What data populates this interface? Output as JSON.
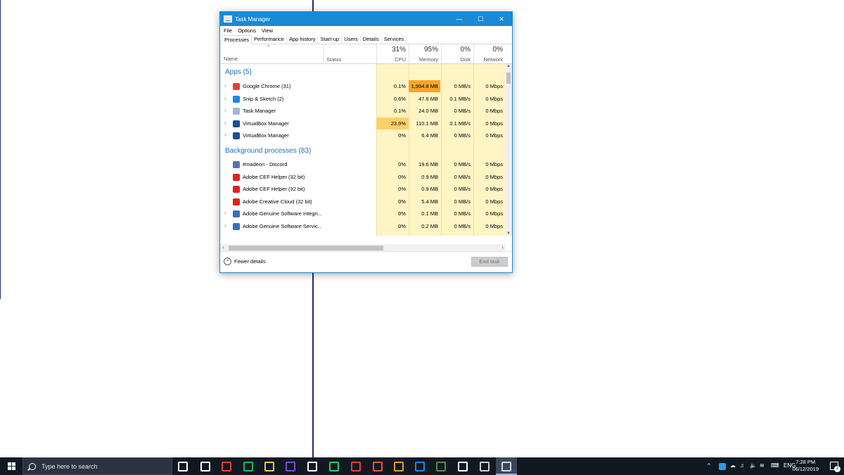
{
  "window": {
    "title": "Task Manager",
    "controls": {
      "minimize": "—",
      "maximize": "☐",
      "close": "✕"
    }
  },
  "menu": [
    "File",
    "Options",
    "View"
  ],
  "tabs": [
    "Processes",
    "Performance",
    "App history",
    "Start-up",
    "Users",
    "Details",
    "Services"
  ],
  "columns": {
    "sort_caret": "^",
    "name": "Name",
    "status": "Status",
    "cpu": {
      "pct": "31%",
      "label": "CPU"
    },
    "memory": {
      "pct": "95%",
      "label": "Memory"
    },
    "disk": {
      "pct": "0%",
      "label": "Disk"
    },
    "network": {
      "pct": "0%",
      "label": "Network"
    }
  },
  "groups": {
    "apps": "Apps (5)",
    "background": "Background processes (83)"
  },
  "apps": [
    {
      "name": "Google Chrome (31)",
      "cpu": "0.1%",
      "memory": "1,994.8 MB",
      "disk": "0 MB/s",
      "network": "0 Mbps",
      "icon_color": "#db4437"
    },
    {
      "name": "Snip & Sketch (2)",
      "cpu": "0.6%",
      "memory": "47.6 MB",
      "disk": "0.1 MB/s",
      "network": "0 Mbps",
      "icon_color": "#1e88e5"
    },
    {
      "name": "Task Manager",
      "cpu": "0.1%",
      "memory": "24.0 MB",
      "disk": "0 MB/s",
      "network": "0 Mbps",
      "icon_color": "#9fb8d6"
    },
    {
      "name": "VirtualBox Manager",
      "cpu": "23.9%",
      "memory": "110.1 MB",
      "disk": "0.1 MB/s",
      "network": "0 Mbps",
      "icon_color": "#1d4f91"
    },
    {
      "name": "VirtualBox Manager",
      "cpu": "0%",
      "memory": "6.4 MB",
      "disk": "0 MB/s",
      "network": "0 Mbps",
      "icon_color": "#1d4f91"
    }
  ],
  "background": [
    {
      "name": "#madeon - Discord",
      "cpu": "0%",
      "memory": "19.6 MB",
      "disk": "0 MB/s",
      "network": "0 Mbps",
      "icon_color": "#5b6fb5"
    },
    {
      "name": "Adobe CEF Helper (32 bit)",
      "cpu": "0%",
      "memory": "0.9 MB",
      "disk": "0 MB/s",
      "network": "0 Mbps",
      "icon_color": "#e0231b"
    },
    {
      "name": "Adobe CEF Helper (32 bit)",
      "cpu": "0%",
      "memory": "0.9 MB",
      "disk": "0 MB/s",
      "network": "0 Mbps",
      "icon_color": "#e0231b"
    },
    {
      "name": "Adobe Creative Cloud (32 bit)",
      "cpu": "0%",
      "memory": "5.4 MB",
      "disk": "0 MB/s",
      "network": "0 Mbps",
      "icon_color": "#e0231b"
    },
    {
      "name": "Adobe Genuine Software Integri...",
      "cpu": "0%",
      "memory": "0.1 MB",
      "disk": "0 MB/s",
      "network": "0 Mbps",
      "icon_color": "#3b6fb6"
    },
    {
      "name": "Adobe Genuine Software Servic...",
      "cpu": "0%",
      "memory": "0.2 MB",
      "disk": "0 MB/s",
      "network": "0 Mbps",
      "icon_color": "#3b6fb6"
    }
  ],
  "footer": {
    "fewer_details": "Fewer details",
    "end_task": "End task"
  },
  "taskbar": {
    "search_placeholder": "Type here to search",
    "apps": [
      {
        "name": "task-view-icon",
        "color": "#ffffff"
      },
      {
        "name": "calendar-icon",
        "color": "#ffffff"
      },
      {
        "name": "chrome-icon",
        "color": "#db4437"
      },
      {
        "name": "spotify-icon",
        "color": "#1db954"
      },
      {
        "name": "file-explorer-icon",
        "color": "#f4c542"
      },
      {
        "name": "affinity-icon",
        "color": "#7a4bd1"
      },
      {
        "name": "photos-icon",
        "color": "#ffffff"
      },
      {
        "name": "whatsapp-icon",
        "color": "#25d366"
      },
      {
        "name": "chrome-canary-icon",
        "color": "#db4437"
      },
      {
        "name": "app-icon",
        "color": "#e25a2c"
      },
      {
        "name": "fl-studio-icon",
        "color": "#f39a1e"
      },
      {
        "name": "snip-sketch-icon",
        "color": "#1e88e5"
      },
      {
        "name": "minecraft-icon",
        "color": "#5c8a3a"
      },
      {
        "name": "virtualbox-icon",
        "color": "#ffffff"
      },
      {
        "name": "tools-icon",
        "color": "#cfcfcf"
      },
      {
        "name": "task-manager-icon",
        "color": "#cfd8e3"
      }
    ],
    "tray": {
      "language": "ENG",
      "time": "7:28 PM",
      "date": "06/12/2019",
      "notifications": "2"
    }
  }
}
